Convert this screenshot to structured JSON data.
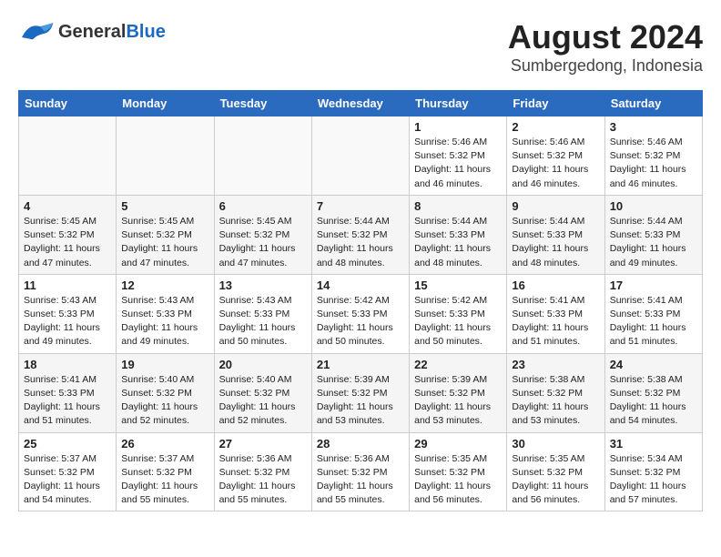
{
  "logo": {
    "text_general": "General",
    "text_blue": "Blue"
  },
  "title": "August 2024",
  "subtitle": "Sumbergedong, Indonesia",
  "weekdays": [
    "Sunday",
    "Monday",
    "Tuesday",
    "Wednesday",
    "Thursday",
    "Friday",
    "Saturday"
  ],
  "weeks": [
    [
      {
        "day": "",
        "info": ""
      },
      {
        "day": "",
        "info": ""
      },
      {
        "day": "",
        "info": ""
      },
      {
        "day": "",
        "info": ""
      },
      {
        "day": "1",
        "info": "Sunrise: 5:46 AM\nSunset: 5:32 PM\nDaylight: 11 hours\nand 46 minutes."
      },
      {
        "day": "2",
        "info": "Sunrise: 5:46 AM\nSunset: 5:32 PM\nDaylight: 11 hours\nand 46 minutes."
      },
      {
        "day": "3",
        "info": "Sunrise: 5:46 AM\nSunset: 5:32 PM\nDaylight: 11 hours\nand 46 minutes."
      }
    ],
    [
      {
        "day": "4",
        "info": "Sunrise: 5:45 AM\nSunset: 5:32 PM\nDaylight: 11 hours\nand 47 minutes."
      },
      {
        "day": "5",
        "info": "Sunrise: 5:45 AM\nSunset: 5:32 PM\nDaylight: 11 hours\nand 47 minutes."
      },
      {
        "day": "6",
        "info": "Sunrise: 5:45 AM\nSunset: 5:32 PM\nDaylight: 11 hours\nand 47 minutes."
      },
      {
        "day": "7",
        "info": "Sunrise: 5:44 AM\nSunset: 5:32 PM\nDaylight: 11 hours\nand 48 minutes."
      },
      {
        "day": "8",
        "info": "Sunrise: 5:44 AM\nSunset: 5:33 PM\nDaylight: 11 hours\nand 48 minutes."
      },
      {
        "day": "9",
        "info": "Sunrise: 5:44 AM\nSunset: 5:33 PM\nDaylight: 11 hours\nand 48 minutes."
      },
      {
        "day": "10",
        "info": "Sunrise: 5:44 AM\nSunset: 5:33 PM\nDaylight: 11 hours\nand 49 minutes."
      }
    ],
    [
      {
        "day": "11",
        "info": "Sunrise: 5:43 AM\nSunset: 5:33 PM\nDaylight: 11 hours\nand 49 minutes."
      },
      {
        "day": "12",
        "info": "Sunrise: 5:43 AM\nSunset: 5:33 PM\nDaylight: 11 hours\nand 49 minutes."
      },
      {
        "day": "13",
        "info": "Sunrise: 5:43 AM\nSunset: 5:33 PM\nDaylight: 11 hours\nand 50 minutes."
      },
      {
        "day": "14",
        "info": "Sunrise: 5:42 AM\nSunset: 5:33 PM\nDaylight: 11 hours\nand 50 minutes."
      },
      {
        "day": "15",
        "info": "Sunrise: 5:42 AM\nSunset: 5:33 PM\nDaylight: 11 hours\nand 50 minutes."
      },
      {
        "day": "16",
        "info": "Sunrise: 5:41 AM\nSunset: 5:33 PM\nDaylight: 11 hours\nand 51 minutes."
      },
      {
        "day": "17",
        "info": "Sunrise: 5:41 AM\nSunset: 5:33 PM\nDaylight: 11 hours\nand 51 minutes."
      }
    ],
    [
      {
        "day": "18",
        "info": "Sunrise: 5:41 AM\nSunset: 5:33 PM\nDaylight: 11 hours\nand 51 minutes."
      },
      {
        "day": "19",
        "info": "Sunrise: 5:40 AM\nSunset: 5:32 PM\nDaylight: 11 hours\nand 52 minutes."
      },
      {
        "day": "20",
        "info": "Sunrise: 5:40 AM\nSunset: 5:32 PM\nDaylight: 11 hours\nand 52 minutes."
      },
      {
        "day": "21",
        "info": "Sunrise: 5:39 AM\nSunset: 5:32 PM\nDaylight: 11 hours\nand 53 minutes."
      },
      {
        "day": "22",
        "info": "Sunrise: 5:39 AM\nSunset: 5:32 PM\nDaylight: 11 hours\nand 53 minutes."
      },
      {
        "day": "23",
        "info": "Sunrise: 5:38 AM\nSunset: 5:32 PM\nDaylight: 11 hours\nand 53 minutes."
      },
      {
        "day": "24",
        "info": "Sunrise: 5:38 AM\nSunset: 5:32 PM\nDaylight: 11 hours\nand 54 minutes."
      }
    ],
    [
      {
        "day": "25",
        "info": "Sunrise: 5:37 AM\nSunset: 5:32 PM\nDaylight: 11 hours\nand 54 minutes."
      },
      {
        "day": "26",
        "info": "Sunrise: 5:37 AM\nSunset: 5:32 PM\nDaylight: 11 hours\nand 55 minutes."
      },
      {
        "day": "27",
        "info": "Sunrise: 5:36 AM\nSunset: 5:32 PM\nDaylight: 11 hours\nand 55 minutes."
      },
      {
        "day": "28",
        "info": "Sunrise: 5:36 AM\nSunset: 5:32 PM\nDaylight: 11 hours\nand 55 minutes."
      },
      {
        "day": "29",
        "info": "Sunrise: 5:35 AM\nSunset: 5:32 PM\nDaylight: 11 hours\nand 56 minutes."
      },
      {
        "day": "30",
        "info": "Sunrise: 5:35 AM\nSunset: 5:32 PM\nDaylight: 11 hours\nand 56 minutes."
      },
      {
        "day": "31",
        "info": "Sunrise: 5:34 AM\nSunset: 5:32 PM\nDaylight: 11 hours\nand 57 minutes."
      }
    ]
  ]
}
